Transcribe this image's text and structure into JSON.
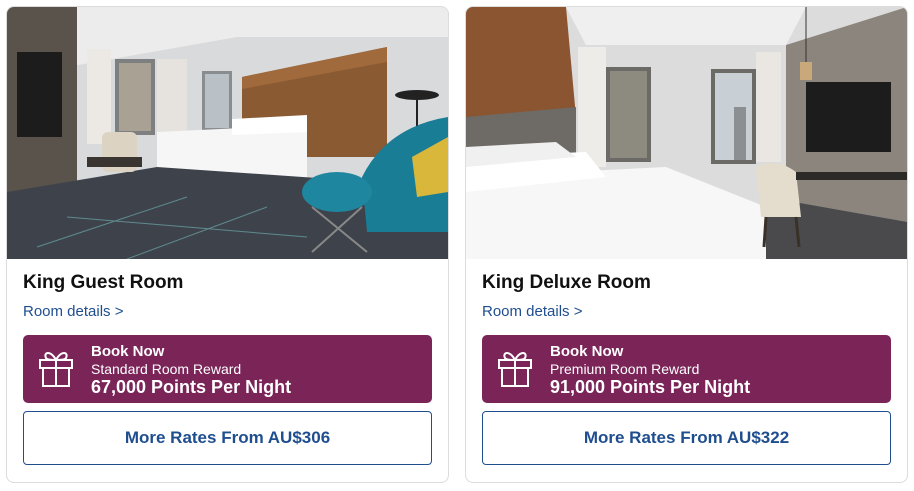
{
  "rooms": [
    {
      "name": "King Guest Room",
      "details_link": "Room details >",
      "reward": {
        "action": "Book Now",
        "type": "Standard Room Reward",
        "points": "67,000 Points Per Night"
      },
      "more_rates": "More Rates From AU$306"
    },
    {
      "name": "King Deluxe Room",
      "details_link": "Room details >",
      "reward": {
        "action": "Book Now",
        "type": "Premium Room Reward",
        "points": "91,000 Points Per Night"
      },
      "more_rates": "More Rates From AU$322"
    }
  ],
  "colors": {
    "reward_bg": "#7a2458",
    "link_blue": "#1f4e8f",
    "teal_chair": "#1a7d96"
  },
  "icons": [
    "gift-icon"
  ]
}
